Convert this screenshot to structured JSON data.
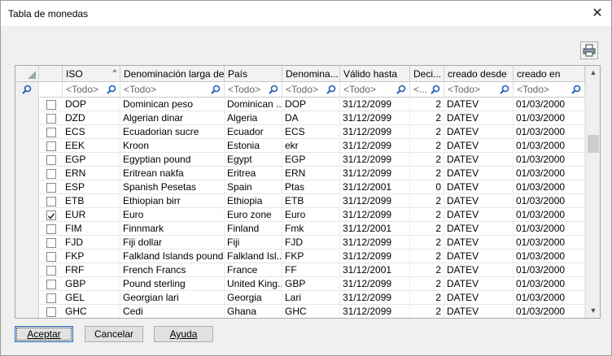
{
  "window": {
    "title": "Tabla de monedas"
  },
  "columns": [
    {
      "label": "ISO",
      "filter": "<Todo>"
    },
    {
      "label": "Denominación larga de...",
      "filter": "<Todo>"
    },
    {
      "label": "País",
      "filter": "<Todo>"
    },
    {
      "label": "Denomina...",
      "filter": "<Todo>"
    },
    {
      "label": "Válido hasta",
      "filter": "<Todo>"
    },
    {
      "label": "Deci...",
      "filter": "<..."
    },
    {
      "label": "creado desde",
      "filter": "<Todo>"
    },
    {
      "label": "creado en",
      "filter": "<Todo>"
    }
  ],
  "rows": [
    {
      "checked": false,
      "cells": [
        "DOP",
        "Dominican peso",
        "Dominican ...",
        "DOP",
        "31/12/2099",
        "2",
        "DATEV",
        "01/03/2000"
      ]
    },
    {
      "checked": false,
      "cells": [
        "DZD",
        "Algerian dinar",
        "Algeria",
        "DA",
        "31/12/2099",
        "2",
        "DATEV",
        "01/03/2000"
      ]
    },
    {
      "checked": false,
      "cells": [
        "ECS",
        "Ecuadorian sucre",
        "Ecuador",
        "ECS",
        "31/12/2099",
        "2",
        "DATEV",
        "01/03/2000"
      ]
    },
    {
      "checked": false,
      "cells": [
        "EEK",
        "Kroon",
        "Estonia",
        "ekr",
        "31/12/2099",
        "2",
        "DATEV",
        "01/03/2000"
      ]
    },
    {
      "checked": false,
      "cells": [
        "EGP",
        "Egyptian pound",
        "Egypt",
        "EGP",
        "31/12/2099",
        "2",
        "DATEV",
        "01/03/2000"
      ]
    },
    {
      "checked": false,
      "cells": [
        "ERN",
        "Eritrean nakfa",
        "Eritrea",
        "ERN",
        "31/12/2099",
        "2",
        "DATEV",
        "01/03/2000"
      ]
    },
    {
      "checked": false,
      "cells": [
        "ESP",
        "Spanish Pesetas",
        "Spain",
        "Ptas",
        "31/12/2001",
        "0",
        "DATEV",
        "01/03/2000"
      ]
    },
    {
      "checked": false,
      "cells": [
        "ETB",
        "Ethiopian birr",
        "Ethiopia",
        "ETB",
        "31/12/2099",
        "2",
        "DATEV",
        "01/03/2000"
      ]
    },
    {
      "checked": true,
      "cells": [
        "EUR",
        "Euro",
        "Euro zone",
        "Euro",
        "31/12/2099",
        "2",
        "DATEV",
        "01/03/2000"
      ]
    },
    {
      "checked": false,
      "cells": [
        "FIM",
        "Finnmark",
        "Finland",
        "Fmk",
        "31/12/2001",
        "2",
        "DATEV",
        "01/03/2000"
      ]
    },
    {
      "checked": false,
      "cells": [
        "FJD",
        "Fiji dollar",
        "Fiji",
        "FJD",
        "31/12/2099",
        "2",
        "DATEV",
        "01/03/2000"
      ]
    },
    {
      "checked": false,
      "cells": [
        "FKP",
        "Falkland Islands pound",
        "Falkland Isl...",
        "FKP",
        "31/12/2099",
        "2",
        "DATEV",
        "01/03/2000"
      ]
    },
    {
      "checked": false,
      "cells": [
        "FRF",
        "French Francs",
        "France",
        "FF",
        "31/12/2001",
        "2",
        "DATEV",
        "01/03/2000"
      ]
    },
    {
      "checked": false,
      "cells": [
        "GBP",
        "Pound sterling",
        "United King...",
        "GBP",
        "31/12/2099",
        "2",
        "DATEV",
        "01/03/2000"
      ]
    },
    {
      "checked": false,
      "cells": [
        "GEL",
        "Georgian lari",
        "Georgia",
        "Lari",
        "31/12/2099",
        "2",
        "DATEV",
        "01/03/2000"
      ]
    },
    {
      "checked": false,
      "cells": [
        "GHC",
        "Cedi",
        "Ghana",
        "GHC",
        "31/12/2099",
        "2",
        "DATEV",
        "01/03/2000"
      ]
    }
  ],
  "buttons": {
    "accept": "Aceptar",
    "cancel": "Cancelar",
    "help": "Ayuda"
  },
  "icons": {
    "close": "close-icon",
    "print": "printer-icon",
    "filter": "magnifier-icon",
    "sort": "sort-ascending-icon"
  }
}
